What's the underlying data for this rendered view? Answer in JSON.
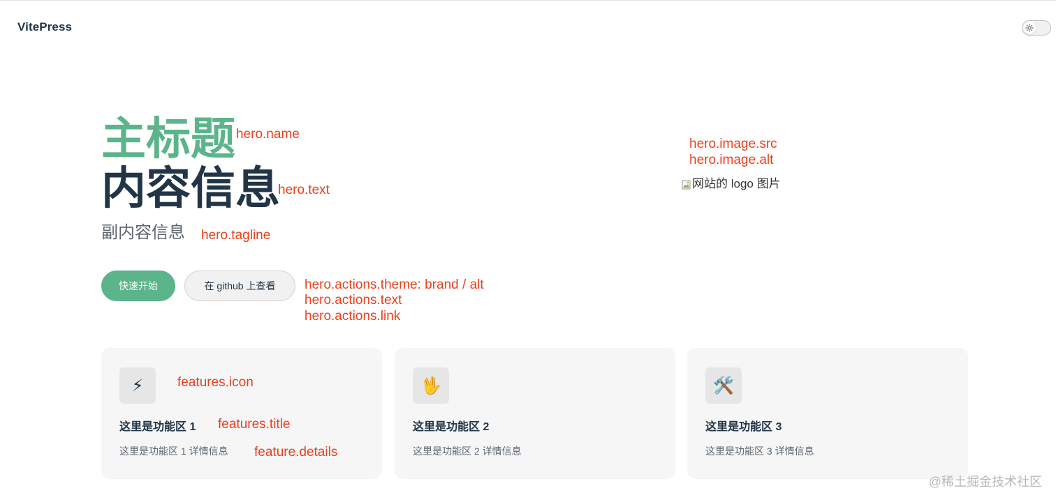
{
  "nav": {
    "title": "VitePress",
    "theme_switch_icon": "sun-icon"
  },
  "hero": {
    "name": "主标题",
    "text": "内容信息",
    "tagline": "副内容信息",
    "actions": [
      {
        "label": "快速开始",
        "theme": "brand"
      },
      {
        "label": "在 github 上查看",
        "theme": "alt"
      }
    ],
    "image_alt": "网站的 logo 图片"
  },
  "annotations": {
    "name": "hero.name",
    "text": "hero.text",
    "tagline": "hero.tagline",
    "actions_theme": "hero.actions.theme: brand / alt",
    "actions_text": "hero.actions.text",
    "actions_link": "hero.actions.link",
    "image_src": "hero.image.src",
    "image_alt": "hero.image.alt",
    "features_icon": "features.icon",
    "features_title": "features.title",
    "features_details": "feature.details"
  },
  "features": [
    {
      "icon": "⚡",
      "icon_name": "lightning-icon",
      "title": "这里是功能区 1",
      "details": "这里是功能区 1 详情信息"
    },
    {
      "icon": "🖖",
      "icon_name": "vulcan-salute-icon",
      "title": "这里是功能区 2",
      "details": "这里是功能区 2 详情信息"
    },
    {
      "icon": "🛠️",
      "icon_name": "tools-icon",
      "title": "这里是功能区 3",
      "details": "这里是功能区 3 详情信息"
    }
  ],
  "watermark": "@稀土掘金技术社区",
  "colors": {
    "brand": "#5cb48a",
    "annotation": "#e8401c",
    "heading": "#213547"
  }
}
